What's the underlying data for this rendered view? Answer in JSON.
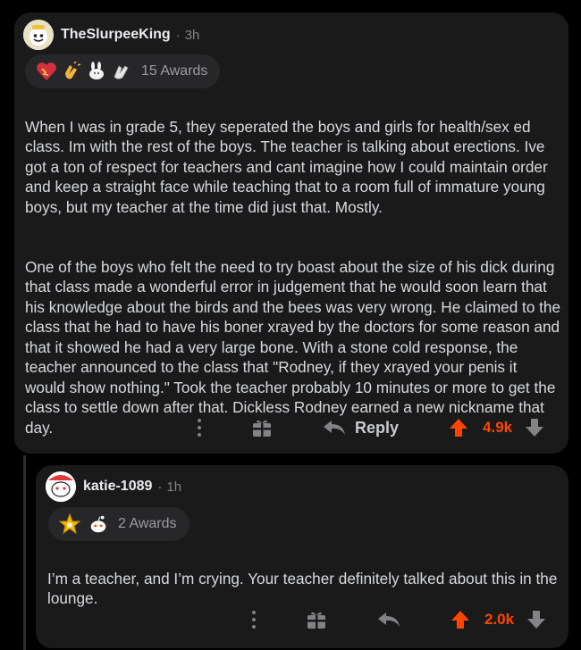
{
  "comments": [
    {
      "username": "TheSlurpeeKing",
      "time": "3h",
      "awards_label": "15 Awards",
      "award_icons": [
        "heart-award-icon",
        "clapping-hands-award-icon",
        "bunny-award-icon",
        "hands-award-icon"
      ],
      "paragraph1": "When I was in grade 5, they seperated the boys and girls for health/sex ed class. Im with the rest of the boys. The teacher is talking about erections. Ive got a ton of respect for teachers and cant imagine how I could maintain order and keep a straight face while teaching that to a room full of immature young boys, but my teacher at the time did just that. Mostly.",
      "paragraph2": "One of the boys who felt the need to try boast about the size of his dick during that class made a wonderful error in judgement that he would soon learn that his knowledge about the birds and the bees was very wrong. He claimed to the class that he had to have his boner xrayed by the doctors for some reason and that it showed he had a very large bone. With a stone cold response, the teacher announced to the class that \"Rodney, if they xrayed your penis it would show nothing.\" Took the teacher probably 10 minutes or more to get the class to settle down after that. Dickless Rodney earned a new nickname that day.",
      "reply_label": "Reply",
      "score": "4.9k"
    },
    {
      "username": "katie-1089",
      "time": "1h",
      "awards_label": "2 Awards",
      "award_icons": [
        "star-award-icon",
        "snoo-award-icon"
      ],
      "paragraph1": "I’m a teacher, and I’m crying. Your teacher definitely talked about this in the lounge.",
      "score": "2.0k"
    }
  ],
  "meta_separator": "·",
  "colors": {
    "background": "#000000",
    "card": "#1a1a1b",
    "upvote": "#ff4500",
    "text": "#d7dadc"
  }
}
